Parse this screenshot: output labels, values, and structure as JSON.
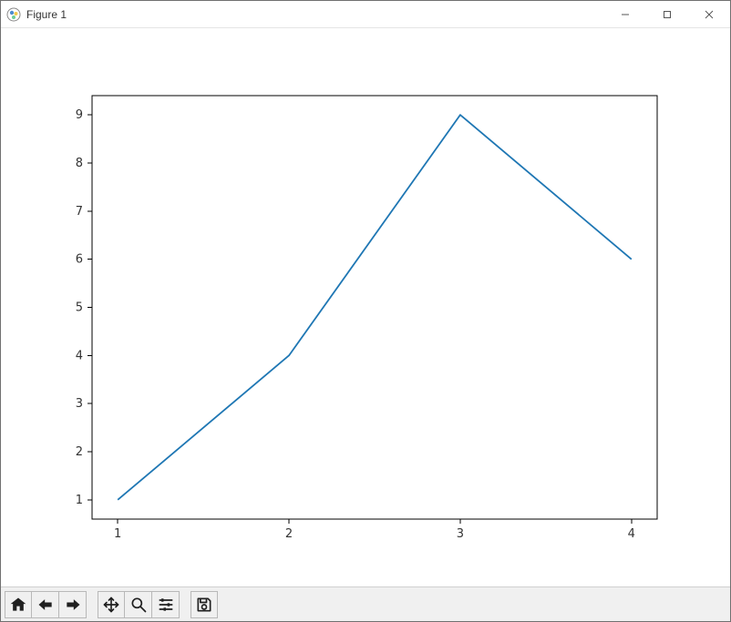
{
  "window": {
    "title": "Figure 1"
  },
  "toolbar": {
    "home_label": "Home",
    "back_label": "Back",
    "forward_label": "Forward",
    "pan_label": "Pan",
    "zoom_label": "Zoom",
    "configure_label": "Configure subplots",
    "save_label": "Save"
  },
  "chart_data": {
    "type": "line",
    "x": [
      1,
      2,
      3,
      4
    ],
    "y": [
      1,
      4,
      9,
      6
    ],
    "x_ticks": [
      1,
      2,
      3,
      4
    ],
    "y_ticks": [
      1,
      2,
      3,
      4,
      5,
      6,
      7,
      8,
      9
    ],
    "xlim": [
      0.85,
      4.15
    ],
    "ylim": [
      0.6,
      9.4
    ],
    "series_color": "#1f77b4",
    "title": "",
    "xlabel": "",
    "ylabel": ""
  }
}
